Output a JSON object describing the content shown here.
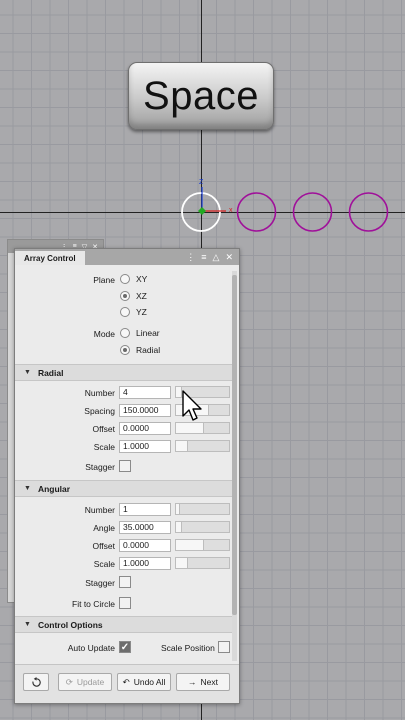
{
  "keycap": {
    "label": "Space"
  },
  "gizmo": {
    "z_label": "Z",
    "x_label": "x"
  },
  "panel": {
    "title": "Array Control",
    "plane": {
      "label": "Plane",
      "options": [
        "XY",
        "XZ",
        "YZ"
      ],
      "selected": "XZ"
    },
    "mode": {
      "label": "Mode",
      "options": [
        "Linear",
        "Radial"
      ],
      "selected": "Radial"
    },
    "radial": {
      "title": "Radial",
      "number": {
        "label": "Number",
        "value": "4",
        "fill": 0.1
      },
      "spacing": {
        "label": "Spacing",
        "value": "150.0000",
        "fill": 0.6
      },
      "offset": {
        "label": "Offset",
        "value": "0.0000",
        "fill": 0.5
      },
      "scale": {
        "label": "Scale",
        "value": "1.0000",
        "fill": 0.2
      },
      "stagger": {
        "label": "Stagger",
        "checked": false
      }
    },
    "angular": {
      "title": "Angular",
      "number": {
        "label": "Number",
        "value": "1",
        "fill": 0.05
      },
      "angle": {
        "label": "Angle",
        "value": "35.0000",
        "fill": 0.1
      },
      "offset": {
        "label": "Offset",
        "value": "0.0000",
        "fill": 0.5
      },
      "scale": {
        "label": "Scale",
        "value": "1.0000",
        "fill": 0.2
      },
      "stagger": {
        "label": "Stagger",
        "checked": false
      },
      "fit_to_circle": {
        "label": "Fit to Circle",
        "checked": false
      }
    },
    "control": {
      "title": "Control Options",
      "auto_update": {
        "label": "Auto Update",
        "checked": true
      },
      "scale_position": {
        "label": "Scale Position",
        "checked": false
      }
    },
    "footer": {
      "update_label": "Update",
      "undo_all_label": "Undo All",
      "next_label": "Next"
    }
  },
  "colors": {
    "circle": "#a0109a",
    "gizmo_z": "#1a3fd8",
    "gizmo_x": "#d42020",
    "gizmo_center": "#22aa22"
  }
}
